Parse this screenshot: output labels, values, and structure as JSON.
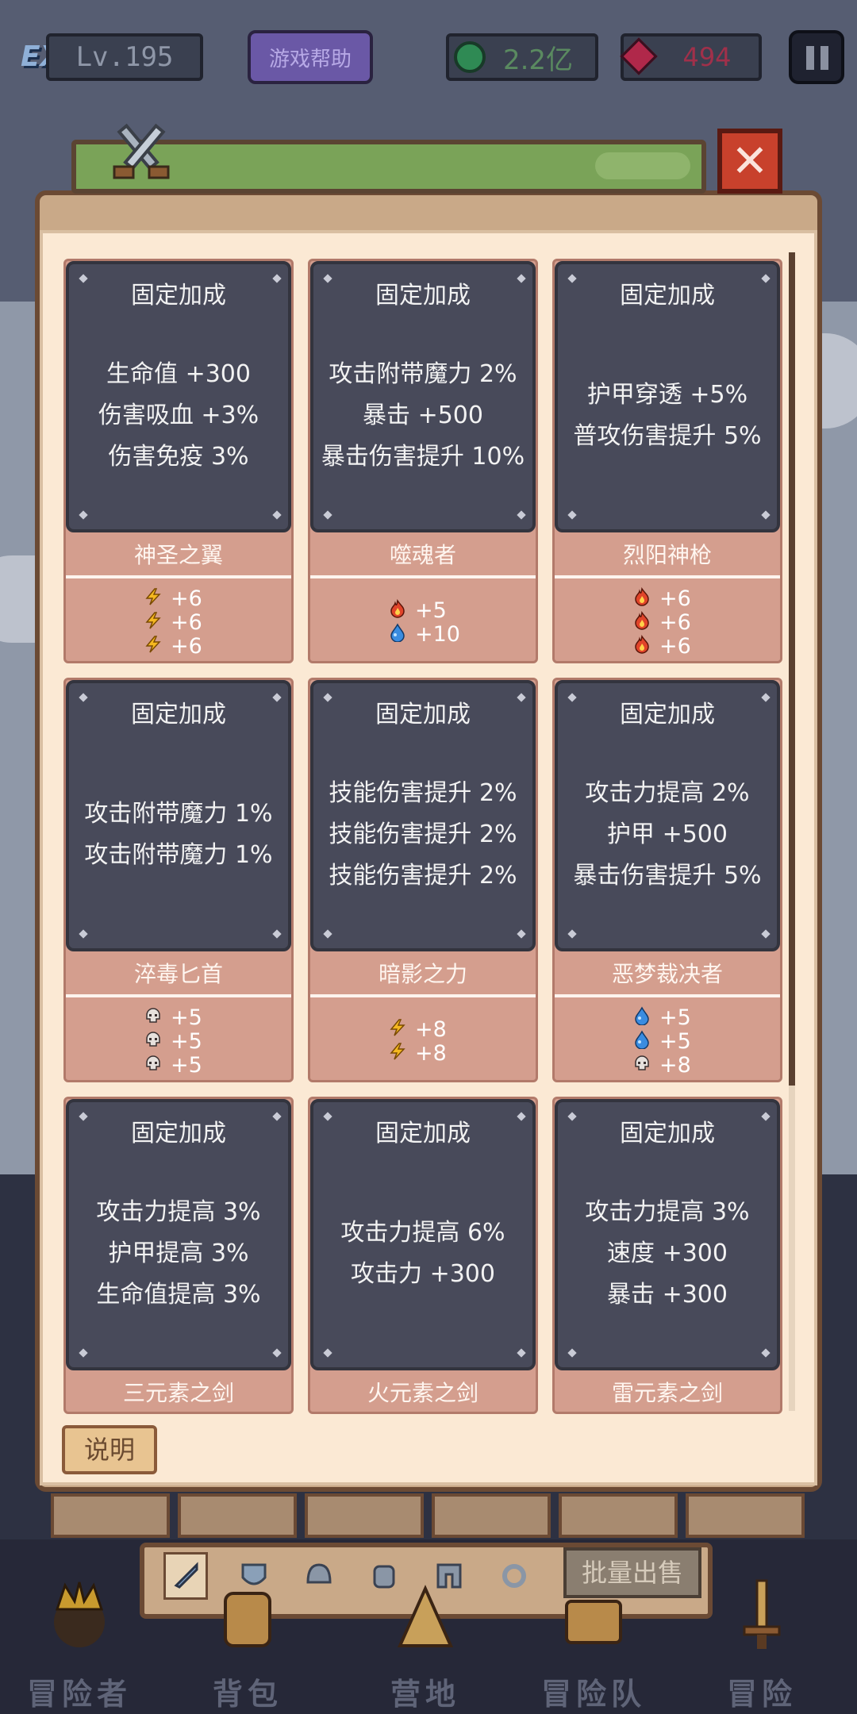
{
  "hud": {
    "exp_logo": "EXP",
    "level": "Lv.195",
    "help": "游戏帮助",
    "gems": "2.2亿",
    "rubies": "494"
  },
  "colors": {
    "panel": "#fbe9d4",
    "card_top": "#484a5a",
    "card_bottom": "#d49e8e",
    "energy": "#f5b820",
    "fire": "#e0442a",
    "water": "#3a8ce0",
    "skull": "#e6e0dc"
  },
  "cards": [
    {
      "title": "固定加成",
      "name": "神圣之翼",
      "stats": [
        "生命值 +300",
        "伤害吸血 +3%",
        "伤害免疫 3%"
      ],
      "bonuses": [
        {
          "icon": "lightning-icon",
          "value": "+6"
        },
        {
          "icon": "lightning-icon",
          "value": "+6"
        },
        {
          "icon": "lightning-icon",
          "value": "+6"
        }
      ]
    },
    {
      "title": "固定加成",
      "name": "噬魂者",
      "stats": [
        "攻击附带魔力 2%",
        "暴击 +500",
        "暴击伤害提升 10%"
      ],
      "bonuses": [
        {
          "icon": "fire-icon",
          "value": "+5"
        },
        {
          "icon": "water-icon",
          "value": "+10"
        }
      ]
    },
    {
      "title": "固定加成",
      "name": "烈阳神枪",
      "stats": [
        "护甲穿透 +5%",
        "普攻伤害提升 5%"
      ],
      "bonuses": [
        {
          "icon": "fire-icon",
          "value": "+6"
        },
        {
          "icon": "fire-icon",
          "value": "+6"
        },
        {
          "icon": "fire-icon",
          "value": "+6"
        }
      ]
    },
    {
      "title": "固定加成",
      "name": "淬毒匕首",
      "stats": [
        "攻击附带魔力 1%",
        "攻击附带魔力 1%"
      ],
      "bonuses": [
        {
          "icon": "skull-icon",
          "value": "+5"
        },
        {
          "icon": "skull-icon",
          "value": "+5"
        },
        {
          "icon": "skull-icon",
          "value": "+5"
        }
      ]
    },
    {
      "title": "固定加成",
      "name": "暗影之力",
      "stats": [
        "技能伤害提升 2%",
        "技能伤害提升 2%",
        "技能伤害提升 2%"
      ],
      "bonuses": [
        {
          "icon": "lightning-icon",
          "value": "+8"
        },
        {
          "icon": "lightning-icon",
          "value": "+8"
        }
      ]
    },
    {
      "title": "固定加成",
      "name": "恶梦裁决者",
      "stats": [
        "攻击力提高 2%",
        "护甲 +500",
        "暴击伤害提升 5%"
      ],
      "bonuses": [
        {
          "icon": "water-icon",
          "value": "+5"
        },
        {
          "icon": "water-icon",
          "value": "+5"
        },
        {
          "icon": "skull-icon",
          "value": "+8"
        }
      ]
    },
    {
      "title": "固定加成",
      "name": "三元素之剑",
      "stats": [
        "攻击力提高 3%",
        "护甲提高 3%",
        "生命值提高 3%"
      ],
      "bonuses": []
    },
    {
      "title": "固定加成",
      "name": "火元素之剑",
      "stats": [
        "攻击力提高 6%",
        "攻击力 +300"
      ],
      "bonuses": []
    },
    {
      "title": "固定加成",
      "name": "雷元素之剑",
      "stats": [
        "攻击力提高 3%",
        "速度 +300",
        "暴击 +300"
      ],
      "bonuses": []
    }
  ],
  "explain_button": "说明",
  "sell_button": "批量出售",
  "tabs": [
    "sword-icon",
    "shield-icon",
    "helmet-icon",
    "armor-icon",
    "pants-icon",
    "ring-icon"
  ],
  "nav": [
    "冒险者",
    "背包",
    "营地",
    "冒险队",
    "冒险"
  ]
}
